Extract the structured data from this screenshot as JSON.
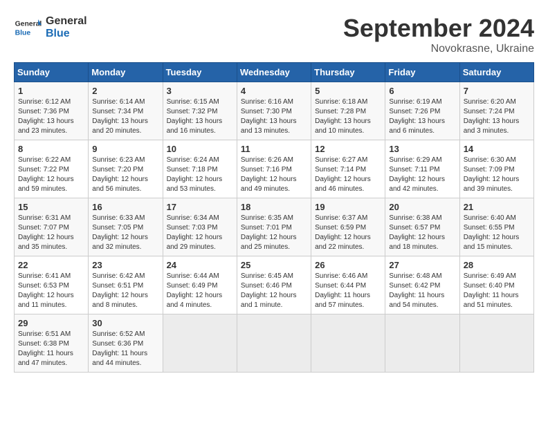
{
  "header": {
    "logo_general": "General",
    "logo_blue": "Blue",
    "month_title": "September 2024",
    "subtitle": "Novokrasne, Ukraine"
  },
  "days_of_week": [
    "Sunday",
    "Monday",
    "Tuesday",
    "Wednesday",
    "Thursday",
    "Friday",
    "Saturday"
  ],
  "weeks": [
    [
      {
        "day": "1",
        "info": "Sunrise: 6:12 AM\nSunset: 7:36 PM\nDaylight: 13 hours\nand 23 minutes."
      },
      {
        "day": "2",
        "info": "Sunrise: 6:14 AM\nSunset: 7:34 PM\nDaylight: 13 hours\nand 20 minutes."
      },
      {
        "day": "3",
        "info": "Sunrise: 6:15 AM\nSunset: 7:32 PM\nDaylight: 13 hours\nand 16 minutes."
      },
      {
        "day": "4",
        "info": "Sunrise: 6:16 AM\nSunset: 7:30 PM\nDaylight: 13 hours\nand 13 minutes."
      },
      {
        "day": "5",
        "info": "Sunrise: 6:18 AM\nSunset: 7:28 PM\nDaylight: 13 hours\nand 10 minutes."
      },
      {
        "day": "6",
        "info": "Sunrise: 6:19 AM\nSunset: 7:26 PM\nDaylight: 13 hours\nand 6 minutes."
      },
      {
        "day": "7",
        "info": "Sunrise: 6:20 AM\nSunset: 7:24 PM\nDaylight: 13 hours\nand 3 minutes."
      }
    ],
    [
      {
        "day": "8",
        "info": "Sunrise: 6:22 AM\nSunset: 7:22 PM\nDaylight: 12 hours\nand 59 minutes."
      },
      {
        "day": "9",
        "info": "Sunrise: 6:23 AM\nSunset: 7:20 PM\nDaylight: 12 hours\nand 56 minutes."
      },
      {
        "day": "10",
        "info": "Sunrise: 6:24 AM\nSunset: 7:18 PM\nDaylight: 12 hours\nand 53 minutes."
      },
      {
        "day": "11",
        "info": "Sunrise: 6:26 AM\nSunset: 7:16 PM\nDaylight: 12 hours\nand 49 minutes."
      },
      {
        "day": "12",
        "info": "Sunrise: 6:27 AM\nSunset: 7:14 PM\nDaylight: 12 hours\nand 46 minutes."
      },
      {
        "day": "13",
        "info": "Sunrise: 6:29 AM\nSunset: 7:11 PM\nDaylight: 12 hours\nand 42 minutes."
      },
      {
        "day": "14",
        "info": "Sunrise: 6:30 AM\nSunset: 7:09 PM\nDaylight: 12 hours\nand 39 minutes."
      }
    ],
    [
      {
        "day": "15",
        "info": "Sunrise: 6:31 AM\nSunset: 7:07 PM\nDaylight: 12 hours\nand 35 minutes."
      },
      {
        "day": "16",
        "info": "Sunrise: 6:33 AM\nSunset: 7:05 PM\nDaylight: 12 hours\nand 32 minutes."
      },
      {
        "day": "17",
        "info": "Sunrise: 6:34 AM\nSunset: 7:03 PM\nDaylight: 12 hours\nand 29 minutes."
      },
      {
        "day": "18",
        "info": "Sunrise: 6:35 AM\nSunset: 7:01 PM\nDaylight: 12 hours\nand 25 minutes."
      },
      {
        "day": "19",
        "info": "Sunrise: 6:37 AM\nSunset: 6:59 PM\nDaylight: 12 hours\nand 22 minutes."
      },
      {
        "day": "20",
        "info": "Sunrise: 6:38 AM\nSunset: 6:57 PM\nDaylight: 12 hours\nand 18 minutes."
      },
      {
        "day": "21",
        "info": "Sunrise: 6:40 AM\nSunset: 6:55 PM\nDaylight: 12 hours\nand 15 minutes."
      }
    ],
    [
      {
        "day": "22",
        "info": "Sunrise: 6:41 AM\nSunset: 6:53 PM\nDaylight: 12 hours\nand 11 minutes."
      },
      {
        "day": "23",
        "info": "Sunrise: 6:42 AM\nSunset: 6:51 PM\nDaylight: 12 hours\nand 8 minutes."
      },
      {
        "day": "24",
        "info": "Sunrise: 6:44 AM\nSunset: 6:49 PM\nDaylight: 12 hours\nand 4 minutes."
      },
      {
        "day": "25",
        "info": "Sunrise: 6:45 AM\nSunset: 6:46 PM\nDaylight: 12 hours\nand 1 minute."
      },
      {
        "day": "26",
        "info": "Sunrise: 6:46 AM\nSunset: 6:44 PM\nDaylight: 11 hours\nand 57 minutes."
      },
      {
        "day": "27",
        "info": "Sunrise: 6:48 AM\nSunset: 6:42 PM\nDaylight: 11 hours\nand 54 minutes."
      },
      {
        "day": "28",
        "info": "Sunrise: 6:49 AM\nSunset: 6:40 PM\nDaylight: 11 hours\nand 51 minutes."
      }
    ],
    [
      {
        "day": "29",
        "info": "Sunrise: 6:51 AM\nSunset: 6:38 PM\nDaylight: 11 hours\nand 47 minutes."
      },
      {
        "day": "30",
        "info": "Sunrise: 6:52 AM\nSunset: 6:36 PM\nDaylight: 11 hours\nand 44 minutes."
      },
      {
        "day": "",
        "info": ""
      },
      {
        "day": "",
        "info": ""
      },
      {
        "day": "",
        "info": ""
      },
      {
        "day": "",
        "info": ""
      },
      {
        "day": "",
        "info": ""
      }
    ]
  ]
}
